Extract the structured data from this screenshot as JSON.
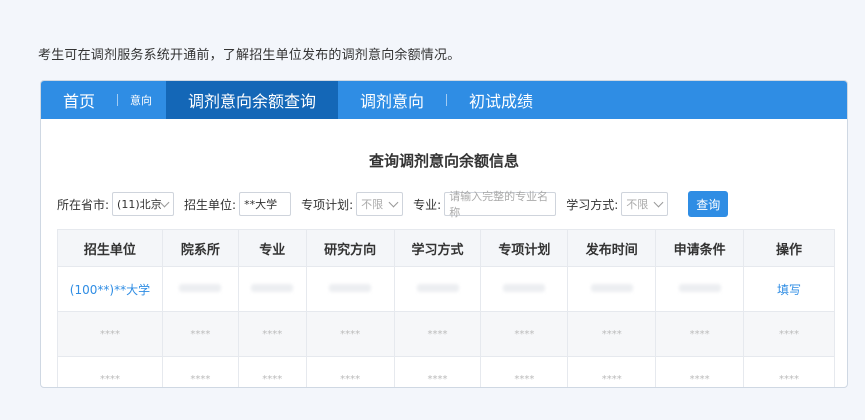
{
  "intro_text": "考生可在调剂服务系统开通前，了解招生单位发布的调剂意向余额情况。",
  "nav": {
    "home": "首页",
    "intent_small": "意向",
    "balance_query": "调剂意向余额查询",
    "intent": "调剂意向",
    "score": "初试成绩"
  },
  "panel_title": "查询调剂意向余额信息",
  "filters": {
    "province_label": "所在省市:",
    "province_value": "(11)北京",
    "unit_label": "招生单位:",
    "unit_value": "**大学",
    "special_label": "专项计划:",
    "special_value": "不限",
    "major_label": "专业:",
    "major_placeholder": "请输入完整的专业名称",
    "study_label": "学习方式:",
    "study_value": "不限",
    "query_button": "查询"
  },
  "table": {
    "headers": [
      "招生单位",
      "院系所",
      "专业",
      "研究方向",
      "学习方式",
      "专项计划",
      "发布时间",
      "申请条件",
      "操作"
    ],
    "row1": {
      "unit": "(100**)**大学",
      "action": "填写"
    },
    "masked": "****"
  }
}
